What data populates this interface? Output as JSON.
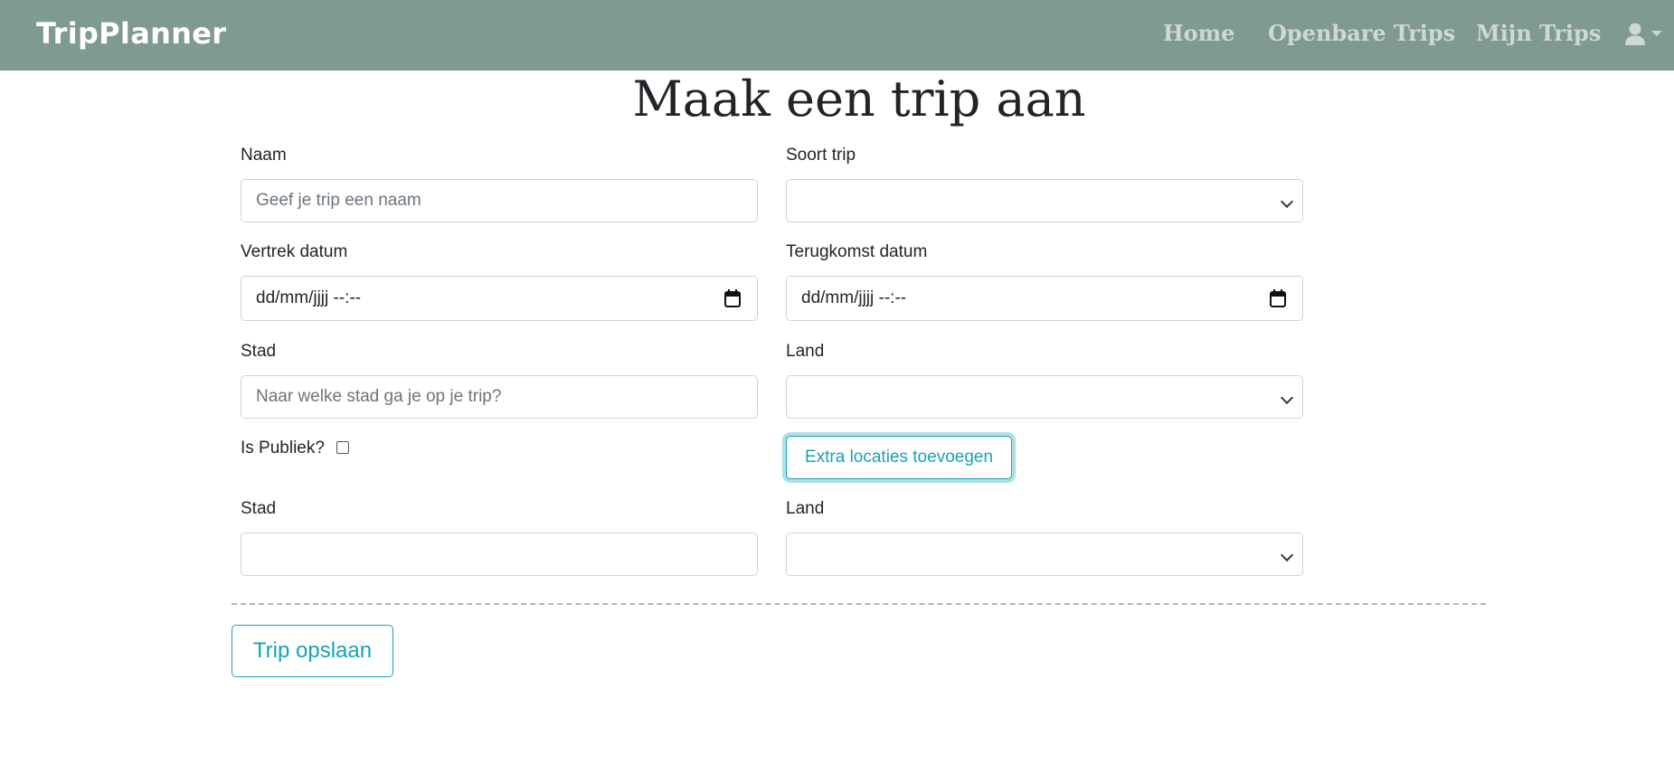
{
  "colors": {
    "navbar_bg": "#7f9a8e",
    "nav_link": "#cfd9d4",
    "accent": "#17a2b8"
  },
  "navbar": {
    "brand": "TripPlanner",
    "links": [
      "Home",
      "Openbare Trips",
      "Mijn Trips"
    ],
    "user_icon": "user-icon"
  },
  "page": {
    "title": "Maak een trip aan"
  },
  "form": {
    "name_label": "Naam",
    "name_placeholder": "Geef je trip een naam",
    "type_label": "Soort trip",
    "type_value": "",
    "departure_label": "Vertrek datum",
    "departure_placeholder": "dd/mm/jjjj --:--",
    "return_label": "Terugkomst datum",
    "return_placeholder": "dd/mm/jjjj --:--",
    "city_label": "Stad",
    "city_placeholder": "Naar welke stad ga je op je trip?",
    "country_label": "Land",
    "country_value": "",
    "public_label": "Is Publiek?",
    "public_checked": false,
    "extra_locations_button": "Extra locaties toevoegen",
    "extra_city_label": "Stad",
    "extra_city_value": "",
    "extra_country_label": "Land",
    "extra_country_value": "",
    "save_button": "Trip opslaan"
  }
}
